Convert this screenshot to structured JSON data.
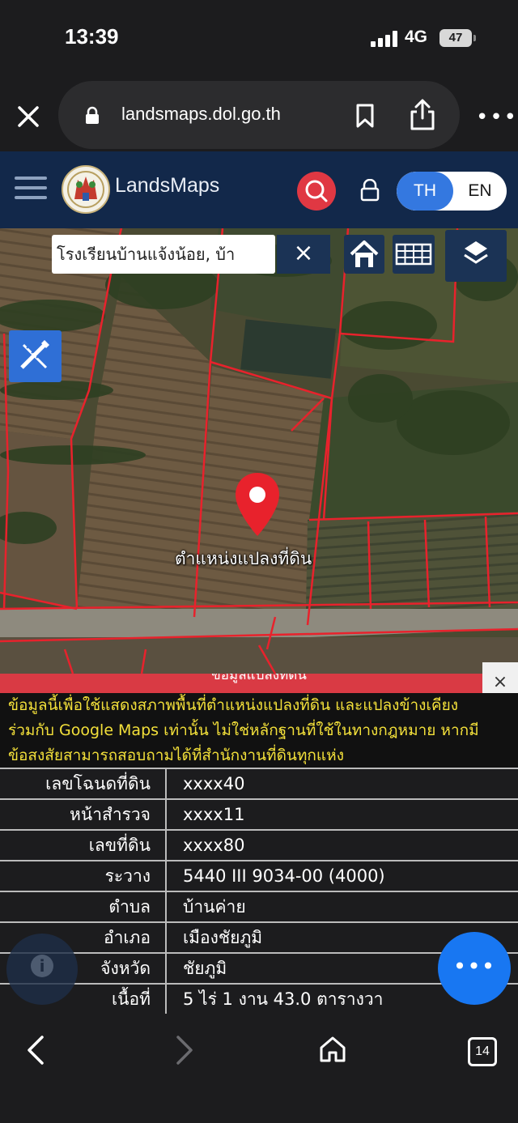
{
  "status_bar": {
    "time": "13:39",
    "network": "4G",
    "battery": "47"
  },
  "browser": {
    "url": "landsmaps.dol.go.th"
  },
  "app": {
    "brand": "LandsMaps",
    "lang_th": "TH",
    "lang_en": "EN"
  },
  "map": {
    "search_value": "โรงเรียนบ้านแจ้งน้อย, บ้า",
    "clear_label": "×",
    "pin_label": "ตำแหน่งแปลงที่ดิน"
  },
  "panel": {
    "title": "ข้อมูลแปลงที่ดิน",
    "close_label": "×",
    "disclaimer": [
      "ข้อมูลนี้เพื่อใช้แสดงสภาพพื้นที่ตำแหน่งแปลงที่ดิน และแปลงข้างเคียง",
      "ร่วมกับ Google Maps เท่านั้น ไม่ใช่หลักฐานที่ใช้ในทางกฎหมาย หากมี",
      "ข้อสงสัยสามารถสอบถามได้ที่สำนักงานที่ดินทุกแห่ง"
    ],
    "rows": [
      {
        "label": "เลขโฉนดที่ดิน",
        "value": "xxxx40"
      },
      {
        "label": "หน้าสำรวจ",
        "value": "xxxx11"
      },
      {
        "label": "เลขที่ดิน",
        "value": "xxxx80"
      },
      {
        "label": "ระวาง",
        "value": "5440 III 9034-00 (4000)"
      },
      {
        "label": "ตำบล",
        "value": "บ้านค่าย"
      },
      {
        "label": "อำเภอ",
        "value": "เมืองชัยภูมิ"
      },
      {
        "label": "จังหวัด",
        "value": "ชัยภูมิ"
      },
      {
        "label": "เนื้อที่",
        "value": "5 ไร่ 1 งาน 43.0 ตารางวา"
      }
    ],
    "info_badge": "i",
    "fab_label": "•••"
  },
  "bottom_nav": {
    "tab_count": "14"
  },
  "colors": {
    "header_bg": "#12284a",
    "accent_blue": "#3478e0",
    "panel_red": "#d93a44",
    "disclaimer_yellow": "#f3e03a",
    "parcel_line": "#e8222c"
  },
  "icons": [
    "close-icon",
    "lock-icon",
    "bookmark-icon",
    "share-icon",
    "more-icon",
    "hamburger-icon",
    "search-icon",
    "padlock-icon",
    "home-icon",
    "grid-icon",
    "layers-icon",
    "ruler-pencil-icon",
    "map-pin-icon",
    "info-icon",
    "back-icon",
    "forward-icon",
    "home-nav-icon",
    "tabs-icon"
  ]
}
